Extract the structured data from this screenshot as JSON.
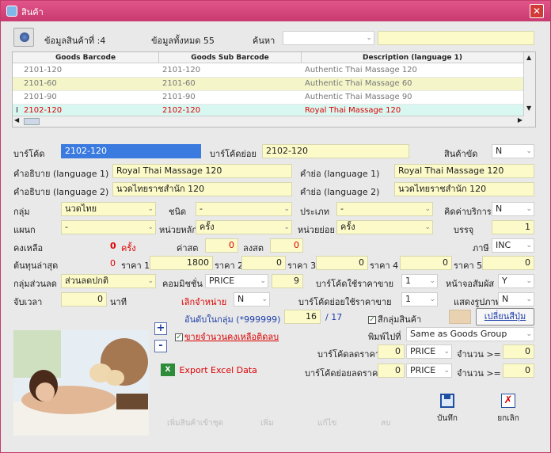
{
  "window": {
    "title": "สินค้า",
    "close": "✕"
  },
  "toolbar": {
    "current_label": "ข้อมูลสินค้าที่ :4",
    "total_label": "ข้อมูลทั้งหมด 55",
    "search_label": "ค้นหา",
    "search_value": ""
  },
  "grid": {
    "headers": [
      "Goods Barcode",
      "Goods Sub Barcode",
      "Description (language 1)"
    ],
    "rows": [
      {
        "marker": "",
        "barcode": "2101-120",
        "sub_barcode": "2101-120",
        "description": "Authentic Thai Massage 120"
      },
      {
        "marker": "",
        "barcode": "2101-60",
        "sub_barcode": "2101-60",
        "description": "Authentic Thai Massage 60"
      },
      {
        "marker": "",
        "barcode": "2101-90",
        "sub_barcode": "2101-90",
        "description": "Authentic Thai Massage 90"
      },
      {
        "marker": "I",
        "barcode": "2102-120",
        "sub_barcode": "2102-120",
        "description": "Royal Thai Massage 120"
      }
    ]
  },
  "form": {
    "barcode_label": "บาร์โค้ด",
    "barcode_value": "2102-120",
    "sub_barcode_label": "บาร์โค้ดย่อย",
    "sub_barcode_value": "2102-120",
    "discontinued_label": "สินค้าขัด",
    "discontinued_value": "N",
    "desc1_label": "คำอธิบาย (language 1)",
    "desc1_value": "Royal Thai Massage 120",
    "short1_label": "คำย่อ (language 1)",
    "short1_value": "Royal Thai Massage 120",
    "desc2_label": "คำอธิบาย (language 2)",
    "desc2_value": "นวดไทยราชสำนัก 120",
    "short2_label": "คำย่อ (language 2)",
    "short2_value": "นวดไทยราชสำนัก 120",
    "group_label": "กลุ่ม",
    "group_value": "นวดไทย",
    "type_label": "ชนิด",
    "type_value": "-",
    "category_label": "ประเภท",
    "category_value": "-",
    "service_fee_label": "คิดค่าบริการ",
    "service_fee_value": "N",
    "dept_label": "แผนก",
    "dept_value": "-",
    "main_unit_label": "หน่วยหลัก",
    "main_unit_value": "ครั้ง",
    "sub_unit_label": "หน่วยย่อย",
    "sub_unit_value": "ครั้ง",
    "pack_label": "บรรจุ",
    "pack_value": "1",
    "stock_label": "คงเหลือ",
    "stock_value": "0",
    "stock_unit": "ครั้ง",
    "cost_label": "ค่าสต",
    "cost_value": "0",
    "cost_total_label": "ลงสต",
    "cost_total_value": "0",
    "tax_label": "ภาษี",
    "tax_value": "INC",
    "last_cost_label": "ต้นทุนล่าสุด",
    "last_cost_value": "0",
    "price1_label": "ราคา 1",
    "price1_value": "1800",
    "price2_label": "ราคา 2",
    "price2_value": "0",
    "price3_label": "ราคา 3",
    "price3_value": "0",
    "price4_label": "ราคา 4",
    "price4_value": "0",
    "price5_label": "ราคา 5",
    "price5_value": "0",
    "discount_group_label": "กลุ่มส่วนลด",
    "discount_group_value": "ส่วนลดปกติ",
    "commission_label": "คอมมิชชั่น",
    "commission_value": "PRICE",
    "commission_amount": "9",
    "use_sale_barcode_label": "บาร์โค้ดใช้ราคาขาย",
    "use_sale_barcode_value": "1",
    "touch_screen_label": "หน้าจอสัมผัส",
    "touch_screen_value": "Y",
    "timer_label": "จับเวลา",
    "timer_value": "0",
    "timer_unit": "นาที",
    "cancel_sale_label": "เลิกจำหน่าย",
    "cancel_sale_value": "N",
    "use_sale_sub_barcode_label": "บาร์โค้ดย่อยใช้ราคาขาย",
    "use_sale_sub_barcode_value": "1",
    "show_image_label": "แสดงรูปภาพ",
    "show_image_value": "N",
    "order_label": "อันดับในกลุ่ม (*999999)",
    "order_value": "16",
    "order_total": "/ 17",
    "color_group_label": "สีกลุ่มสินค้า",
    "change_color_button": "เปลี่ยนสีปุ่ม",
    "sell_stock_label": "ขายจำนวนคงเหลือติดลบ",
    "print_to_label": "พิมพ์ไปที่",
    "print_to_value": "Same as Goods Group",
    "barcode_discount_label": "บาร์โค้ดลดราคา",
    "barcode_discount_value": "0",
    "barcode_discount_type": "PRICE",
    "qty_label": "จำนวน >=",
    "barcode_discount_qty": "0",
    "sub_barcode_discount_label": "บาร์โค้ดย่อยลดราคา",
    "sub_barcode_discount_value": "0",
    "sub_barcode_discount_type": "PRICE",
    "sub_barcode_discount_qty": "0",
    "export_excel_label": "Export Excel Data"
  },
  "footer": {
    "add_set": "เพิ่มสินค้าเข้าชุด",
    "add": "เพิ่ม",
    "edit": "แก้ไข",
    "delete": "ลบ",
    "save": "บันทึก",
    "cancel": "ยกเลิก"
  }
}
